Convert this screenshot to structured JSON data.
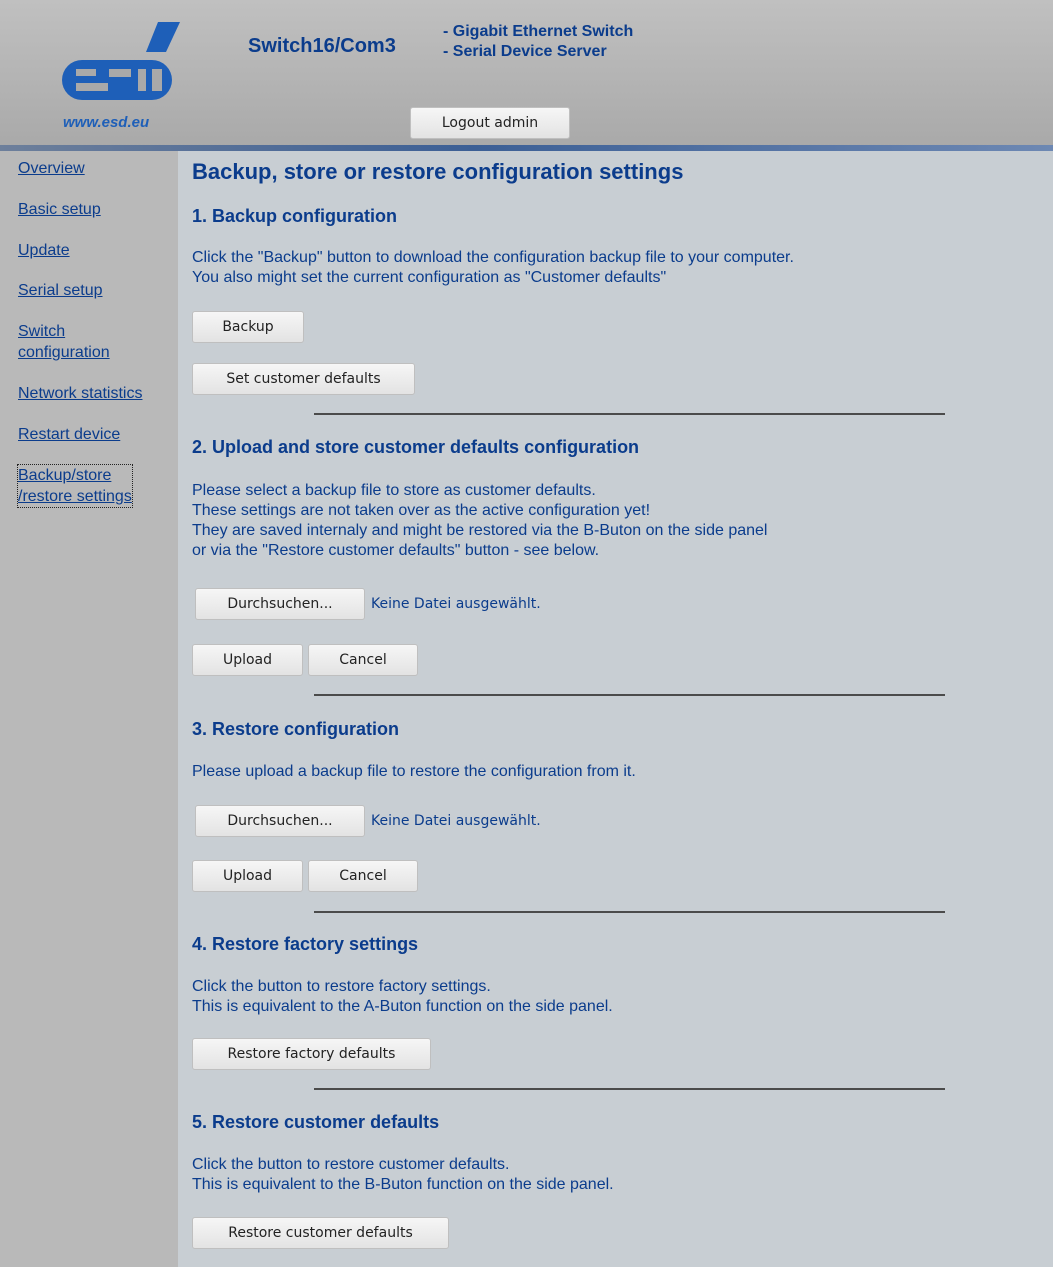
{
  "header": {
    "product_name": "Switch16/Com3",
    "subtitle_line1": "- Gigabit Ethernet Switch",
    "subtitle_line2": "- Serial Device Server",
    "logo_text": "esd",
    "logo_url": "www.esd.eu",
    "logout_label": "Logout admin"
  },
  "sidebar": {
    "items": [
      {
        "label": "Overview"
      },
      {
        "label": "Basic setup"
      },
      {
        "label": "Update"
      },
      {
        "label": "Serial setup"
      },
      {
        "label_line1": "Switch",
        "label_line2": "configuration"
      },
      {
        "label": "Network statistics"
      },
      {
        "label": "Restart device"
      },
      {
        "label_line1": "Backup/store",
        "label_line2": "/restore settings",
        "active": true
      }
    ]
  },
  "main": {
    "title": "Backup, store or restore configuration settings",
    "section1": {
      "heading": "1. Backup configuration",
      "line1": "Click the \"Backup\" button to download the configuration backup file to your computer.",
      "line2": "You also might set the current configuration as \"Customer defaults\"",
      "backup_label": "Backup",
      "set_customer_defaults_label": "Set customer defaults"
    },
    "section2": {
      "heading": "2. Upload and store customer defaults configuration",
      "line1": "Please select a backup file to store as customer defaults.",
      "line2": "These settings are not taken over as the active configuration yet!",
      "line3": "They are saved internaly and might be restored via the B-Buton on the side panel",
      "line4": "or via the \"Restore customer defaults\" button - see below.",
      "browse_label": "Durchsuchen...",
      "file_status": "Keine Datei ausgewählt.",
      "upload_label": "Upload",
      "cancel_label": "Cancel"
    },
    "section3": {
      "heading": "3. Restore configuration",
      "line1": "Please upload a backup file to restore the configuration from it.",
      "browse_label": "Durchsuchen...",
      "file_status": "Keine Datei ausgewählt.",
      "upload_label": "Upload",
      "cancel_label": "Cancel"
    },
    "section4": {
      "heading": "4. Restore factory settings",
      "line1": "Click the button to restore factory settings.",
      "line2": "This is equivalent to the A-Buton function on the side panel.",
      "button_label": "Restore factory defaults"
    },
    "section5": {
      "heading": "5. Restore customer defaults",
      "line1": "Click the button to restore customer defaults.",
      "line2": "This is equivalent to the B-Buton function on the side panel.",
      "button_label": "Restore customer defaults"
    }
  },
  "colors": {
    "text": "#0b3c8c",
    "header_bg": "#a9a9a9",
    "sidebar_bg": "#b9b9b9",
    "main_bg": "#c8ced3",
    "logo_blue": "#1e5fb8"
  }
}
